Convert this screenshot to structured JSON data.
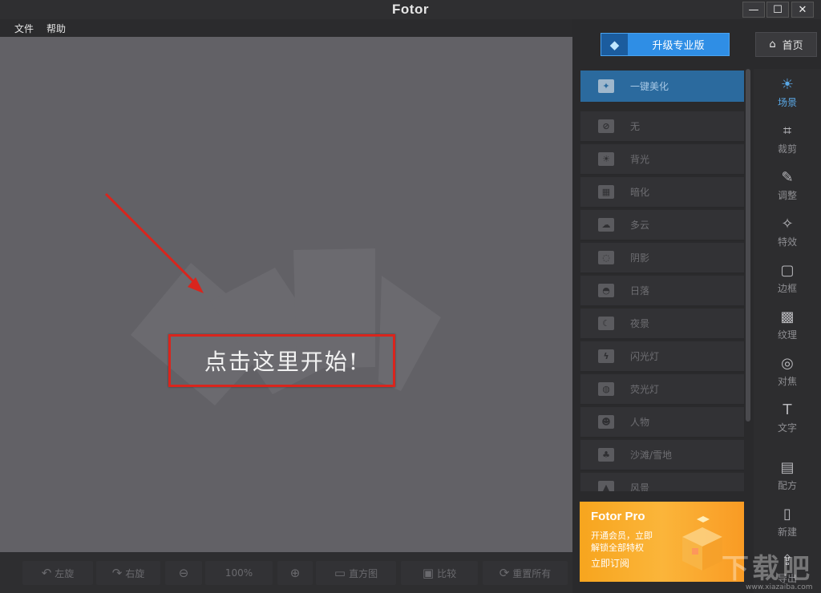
{
  "window": {
    "title": "Fotor",
    "minimize": "—",
    "maximize": "☐",
    "close": "✕"
  },
  "menu": [
    "文件",
    "帮助"
  ],
  "canvas": {
    "start_prompt": "点击这里开始!"
  },
  "bottom_toolbar": [
    {
      "icon": "rotate-left-icon",
      "glyph": "↶",
      "label": "左旋"
    },
    {
      "icon": "rotate-right-icon",
      "glyph": "↷",
      "label": "右旋"
    },
    {
      "icon": "zoom-out-icon",
      "glyph": "⊖",
      "label": ""
    },
    {
      "icon": "",
      "glyph": "",
      "label": "100%"
    },
    {
      "icon": "zoom-in-icon",
      "glyph": "⊕",
      "label": ""
    },
    {
      "icon": "histogram-icon",
      "glyph": "▭",
      "label": "直方图"
    },
    {
      "icon": "compare-icon",
      "glyph": "▣",
      "label": "比较"
    },
    {
      "icon": "reset-icon",
      "glyph": "⟳",
      "label": "重置所有"
    }
  ],
  "header": {
    "upgrade_label": "升级专业版",
    "home_label": "首页"
  },
  "scene_list": [
    {
      "label": "一键美化",
      "glyph": "✦",
      "active": true
    },
    {
      "label": "无",
      "glyph": "⊘",
      "active": false
    },
    {
      "label": "背光",
      "glyph": "☀",
      "active": false
    },
    {
      "label": "暗化",
      "glyph": "▦",
      "active": false
    },
    {
      "label": "多云",
      "glyph": "☁",
      "active": false
    },
    {
      "label": "阴影",
      "glyph": "◌",
      "active": false
    },
    {
      "label": "日落",
      "glyph": "◓",
      "active": false
    },
    {
      "label": "夜景",
      "glyph": "☾",
      "active": false
    },
    {
      "label": "闪光灯",
      "glyph": "ϟ",
      "active": false
    },
    {
      "label": "荧光灯",
      "glyph": "◍",
      "active": false
    },
    {
      "label": "人物",
      "glyph": "☻",
      "active": false
    },
    {
      "label": "沙滩/雪地",
      "glyph": "♣",
      "active": false
    },
    {
      "label": "风景",
      "glyph": "▲",
      "active": false
    }
  ],
  "tools": [
    {
      "label": "场景",
      "glyph": "☀",
      "icon": "scene-icon",
      "active": true
    },
    {
      "label": "裁剪",
      "glyph": "⌗",
      "icon": "crop-icon",
      "active": false
    },
    {
      "label": "调整",
      "glyph": "✎",
      "icon": "adjust-icon",
      "active": false
    },
    {
      "label": "特效",
      "glyph": "✧",
      "icon": "effects-icon",
      "active": false
    },
    {
      "label": "边框",
      "glyph": "▢",
      "icon": "frame-icon",
      "active": false
    },
    {
      "label": "纹理",
      "glyph": "▩",
      "icon": "texture-icon",
      "active": false
    },
    {
      "label": "对焦",
      "glyph": "◎",
      "icon": "focus-icon",
      "active": false
    },
    {
      "label": "文字",
      "glyph": "T",
      "icon": "text-icon",
      "active": false
    },
    {
      "label": "配方",
      "glyph": "▤",
      "icon": "recipe-icon",
      "active": false
    },
    {
      "label": "新建",
      "glyph": "▯",
      "icon": "new-icon",
      "active": false
    },
    {
      "label": "导出",
      "glyph": "⇪",
      "icon": "export-icon",
      "active": false
    }
  ],
  "promo": {
    "title": "Fotor Pro",
    "line1": "开通会员，立即",
    "line2": "解锁全部特权",
    "cta": "立即订阅"
  },
  "watermark": {
    "text": "下载吧",
    "url": "www.xiazaiba.com"
  },
  "colors": {
    "canvas_bg": "#626166",
    "accent_blue": "#2f8ee5",
    "active_item": "#2b6a9e",
    "highlight_red": "#d9251d",
    "promo_orange": "#f7a51e"
  }
}
